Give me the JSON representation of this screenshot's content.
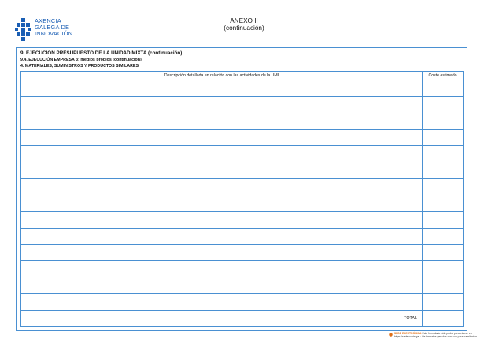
{
  "header": {
    "logo_lines": [
      "AXENCIA",
      "GALEGA DE",
      "INNOVACIÓN"
    ],
    "annex_title": "ANEXO II",
    "annex_subtitle": "(continuación)"
  },
  "sections": {
    "section_9": "9. EJECUCIÓN PRESUPUESTO DE LA UNIDAD MIXTA (continuación)",
    "section_9_4": "9.4. EJECUCIÓN EMPRESA 3: medios propios (continuación)",
    "section_4": "4. MATERIALES, SUMINISTROS Y PRODUCTOS SIMILARES"
  },
  "table": {
    "columns": [
      "Descripción detallada en relación con las actividades de la UMI",
      "Coste estimado"
    ],
    "rows": [
      [
        "",
        ""
      ],
      [
        "",
        ""
      ],
      [
        "",
        ""
      ],
      [
        "",
        ""
      ],
      [
        "",
        ""
      ],
      [
        "",
        ""
      ],
      [
        "",
        ""
      ],
      [
        "",
        ""
      ],
      [
        "",
        ""
      ],
      [
        "",
        ""
      ],
      [
        "",
        ""
      ],
      [
        "",
        ""
      ],
      [
        "",
        ""
      ],
      [
        "",
        ""
      ]
    ],
    "total_label": "TOTAL",
    "total_value": ""
  },
  "footer": {
    "sede_label": "SEDE ELECTRÓNICA",
    "line1": "Este formulario sólo podrá presentarse en",
    "line2": "https://sede.xunta.gal · Os formatos gerados non son para tramitación"
  },
  "colors": {
    "brand_blue": "#1a5eb4",
    "border_blue": "#4a90d2",
    "footer_orange": "#e07018"
  }
}
